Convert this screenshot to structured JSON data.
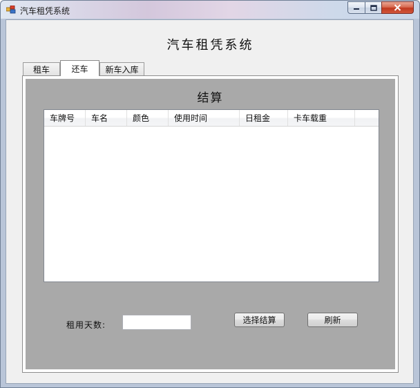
{
  "window": {
    "title": "汽车租凭系统",
    "icons": {
      "app": "app-window-icon",
      "minimize": "minimize-icon",
      "maximize": "maximize-icon",
      "close": "close-icon"
    },
    "colors": {
      "close_button": "#c94a32",
      "titlebar": "#d9dfeb"
    }
  },
  "app": {
    "heading": "汽车租凭系统"
  },
  "tabs": [
    {
      "label": "租车",
      "active": false
    },
    {
      "label": "还车",
      "active": true
    },
    {
      "label": "新车入库",
      "active": false
    }
  ],
  "return_tab": {
    "title": "结算",
    "colors": {
      "panel_background": "#a9a9a9",
      "list_background": "#ffffff"
    },
    "list": {
      "columns": [
        "车牌号",
        "车名",
        "颜色",
        "使用时间",
        "日租金",
        "卡车载重"
      ],
      "rows": []
    },
    "days_label": "租用天数:",
    "days_input": {
      "value": "",
      "placeholder": ""
    },
    "settle_button": "选择结算",
    "refresh_button": "刷新"
  }
}
